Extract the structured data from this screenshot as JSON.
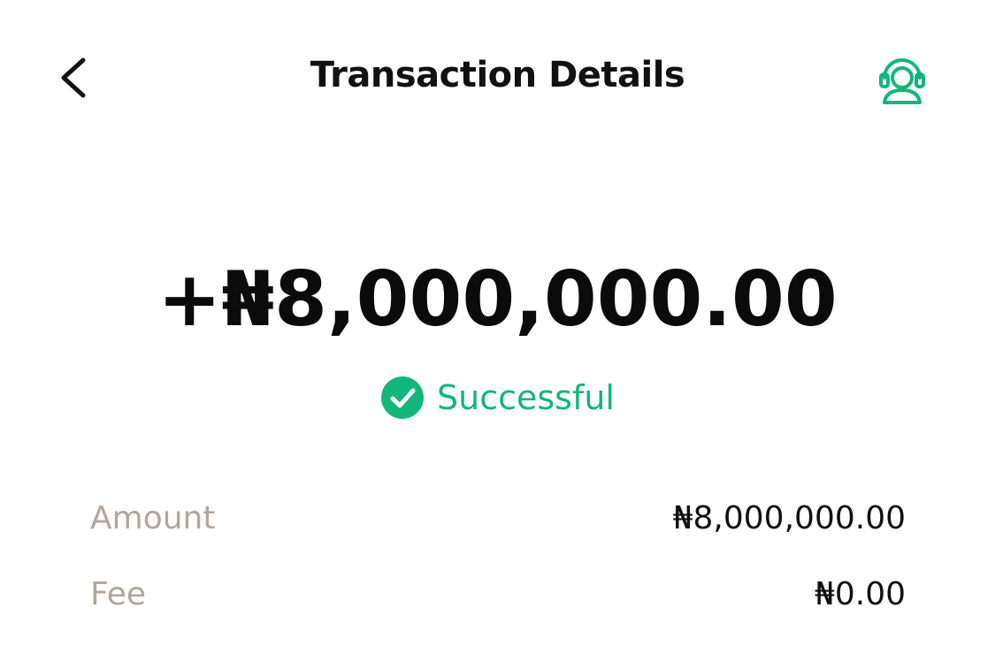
{
  "header": {
    "title": "Transaction Details",
    "back_icon": "chevron-left-icon",
    "support_icon": "customer-support-icon"
  },
  "transaction": {
    "amount_display": "+₦8,000,000.00",
    "status": "Successful",
    "status_icon": "check-circle-icon"
  },
  "details": {
    "amount_label": "Amount",
    "amount_value": "₦8,000,000.00",
    "fee_label": "Fee",
    "fee_value": "₦0.00"
  },
  "colors": {
    "accent": "#13b67a",
    "label": "#b2a69b",
    "text": "#111111"
  }
}
